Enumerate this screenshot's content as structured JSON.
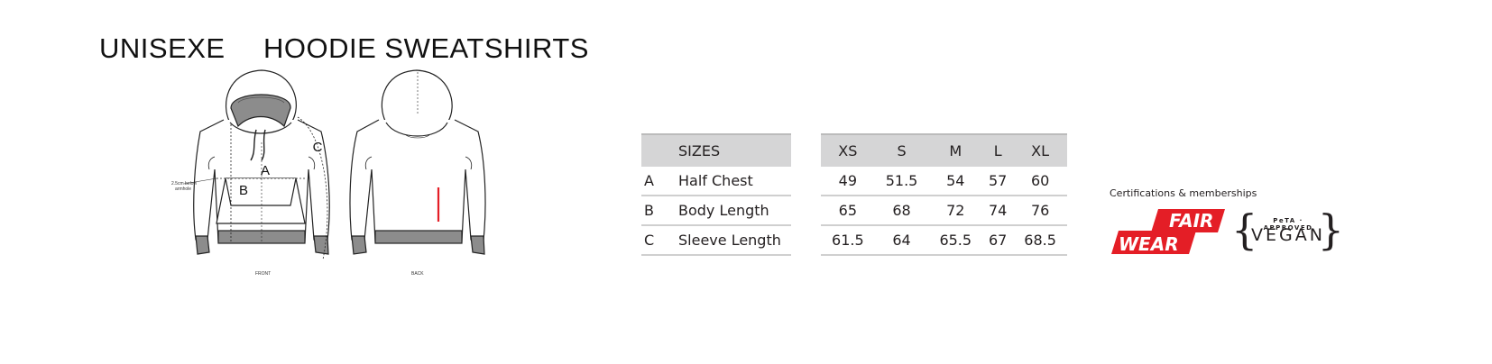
{
  "header": {
    "title_left": "UNISEXE",
    "title_right": "HOODIE SWEATSHIRTS"
  },
  "diagram": {
    "label_a": "A",
    "label_b": "B",
    "label_c": "C",
    "note_line1": "2.5cm below",
    "note_line2": "armhole",
    "front_caption": "FRONT",
    "back_caption": "BACK",
    "accent_color": "#e41e26",
    "trim_color": "#8c8c8c"
  },
  "size_chart": {
    "header_label": "SIZES",
    "sizes": [
      "XS",
      "S",
      "M",
      "L",
      "XL"
    ],
    "rows": [
      {
        "letter": "A",
        "name": "Half Chest",
        "values": [
          "49",
          "51.5",
          "54",
          "57",
          "60"
        ]
      },
      {
        "letter": "B",
        "name": "Body Length",
        "values": [
          "65",
          "68",
          "72",
          "74",
          "76"
        ]
      },
      {
        "letter": "C",
        "name": "Sleeve Length",
        "values": [
          "61.5",
          "64",
          "65.5",
          "67",
          "68.5"
        ]
      }
    ],
    "header_bg": "#d5d5d6"
  },
  "certifications": {
    "heading": "Certifications & memberships",
    "fairwear_top": "FAIR",
    "fairwear_bottom": "WEAR",
    "fairwear_color": "#e41e26",
    "peta_text": "PeTA · APPROVED",
    "vegan_text": "VEGAN",
    "brace_left": "{",
    "brace_right": "}"
  }
}
